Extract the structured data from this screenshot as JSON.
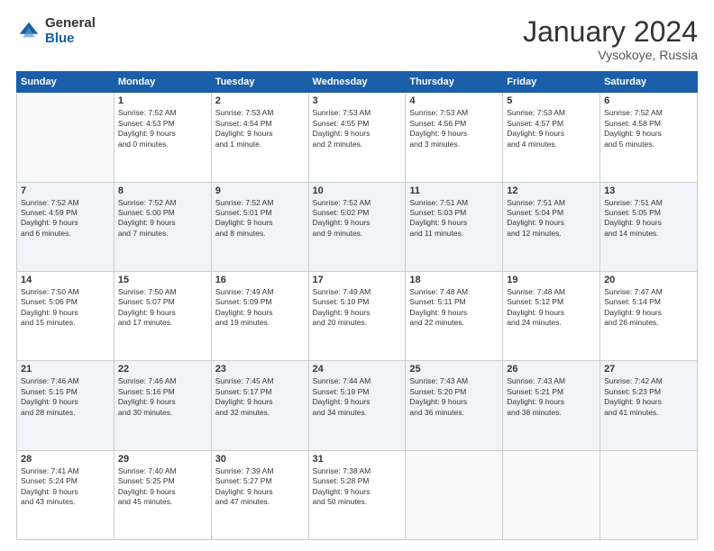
{
  "logo": {
    "general": "General",
    "blue": "Blue"
  },
  "calendar": {
    "title": "January 2024",
    "location": "Vysokoye, Russia",
    "headers": [
      "Sunday",
      "Monday",
      "Tuesday",
      "Wednesday",
      "Thursday",
      "Friday",
      "Saturday"
    ],
    "weeks": [
      [
        {
          "day": "",
          "info": ""
        },
        {
          "day": "1",
          "info": "Sunrise: 7:52 AM\nSunset: 4:53 PM\nDaylight: 9 hours\nand 0 minutes."
        },
        {
          "day": "2",
          "info": "Sunrise: 7:53 AM\nSunset: 4:54 PM\nDaylight: 9 hours\nand 1 minute."
        },
        {
          "day": "3",
          "info": "Sunrise: 7:53 AM\nSunset: 4:55 PM\nDaylight: 9 hours\nand 2 minutes."
        },
        {
          "day": "4",
          "info": "Sunrise: 7:53 AM\nSunset: 4:56 PM\nDaylight: 9 hours\nand 3 minutes."
        },
        {
          "day": "5",
          "info": "Sunrise: 7:53 AM\nSunset: 4:57 PM\nDaylight: 9 hours\nand 4 minutes."
        },
        {
          "day": "6",
          "info": "Sunrise: 7:52 AM\nSunset: 4:58 PM\nDaylight: 9 hours\nand 5 minutes."
        }
      ],
      [
        {
          "day": "7",
          "info": "Sunrise: 7:52 AM\nSunset: 4:59 PM\nDaylight: 9 hours\nand 6 minutes."
        },
        {
          "day": "8",
          "info": "Sunrise: 7:52 AM\nSunset: 5:00 PM\nDaylight: 9 hours\nand 7 minutes."
        },
        {
          "day": "9",
          "info": "Sunrise: 7:52 AM\nSunset: 5:01 PM\nDaylight: 9 hours\nand 8 minutes."
        },
        {
          "day": "10",
          "info": "Sunrise: 7:52 AM\nSunset: 5:02 PM\nDaylight: 9 hours\nand 9 minutes."
        },
        {
          "day": "11",
          "info": "Sunrise: 7:51 AM\nSunset: 5:03 PM\nDaylight: 9 hours\nand 11 minutes."
        },
        {
          "day": "12",
          "info": "Sunrise: 7:51 AM\nSunset: 5:04 PM\nDaylight: 9 hours\nand 12 minutes."
        },
        {
          "day": "13",
          "info": "Sunrise: 7:51 AM\nSunset: 5:05 PM\nDaylight: 9 hours\nand 14 minutes."
        }
      ],
      [
        {
          "day": "14",
          "info": "Sunrise: 7:50 AM\nSunset: 5:06 PM\nDaylight: 9 hours\nand 15 minutes."
        },
        {
          "day": "15",
          "info": "Sunrise: 7:50 AM\nSunset: 5:07 PM\nDaylight: 9 hours\nand 17 minutes."
        },
        {
          "day": "16",
          "info": "Sunrise: 7:49 AM\nSunset: 5:09 PM\nDaylight: 9 hours\nand 19 minutes."
        },
        {
          "day": "17",
          "info": "Sunrise: 7:49 AM\nSunset: 5:10 PM\nDaylight: 9 hours\nand 20 minutes."
        },
        {
          "day": "18",
          "info": "Sunrise: 7:48 AM\nSunset: 5:11 PM\nDaylight: 9 hours\nand 22 minutes."
        },
        {
          "day": "19",
          "info": "Sunrise: 7:48 AM\nSunset: 5:12 PM\nDaylight: 9 hours\nand 24 minutes."
        },
        {
          "day": "20",
          "info": "Sunrise: 7:47 AM\nSunset: 5:14 PM\nDaylight: 9 hours\nand 26 minutes."
        }
      ],
      [
        {
          "day": "21",
          "info": "Sunrise: 7:46 AM\nSunset: 5:15 PM\nDaylight: 9 hours\nand 28 minutes."
        },
        {
          "day": "22",
          "info": "Sunrise: 7:46 AM\nSunset: 5:16 PM\nDaylight: 9 hours\nand 30 minutes."
        },
        {
          "day": "23",
          "info": "Sunrise: 7:45 AM\nSunset: 5:17 PM\nDaylight: 9 hours\nand 32 minutes."
        },
        {
          "day": "24",
          "info": "Sunrise: 7:44 AM\nSunset: 5:19 PM\nDaylight: 9 hours\nand 34 minutes."
        },
        {
          "day": "25",
          "info": "Sunrise: 7:43 AM\nSunset: 5:20 PM\nDaylight: 9 hours\nand 36 minutes."
        },
        {
          "day": "26",
          "info": "Sunrise: 7:43 AM\nSunset: 5:21 PM\nDaylight: 9 hours\nand 38 minutes."
        },
        {
          "day": "27",
          "info": "Sunrise: 7:42 AM\nSunset: 5:23 PM\nDaylight: 9 hours\nand 41 minutes."
        }
      ],
      [
        {
          "day": "28",
          "info": "Sunrise: 7:41 AM\nSunset: 5:24 PM\nDaylight: 9 hours\nand 43 minutes."
        },
        {
          "day": "29",
          "info": "Sunrise: 7:40 AM\nSunset: 5:25 PM\nDaylight: 9 hours\nand 45 minutes."
        },
        {
          "day": "30",
          "info": "Sunrise: 7:39 AM\nSunset: 5:27 PM\nDaylight: 9 hours\nand 47 minutes."
        },
        {
          "day": "31",
          "info": "Sunrise: 7:38 AM\nSunset: 5:28 PM\nDaylight: 9 hours\nand 50 minutes."
        },
        {
          "day": "",
          "info": ""
        },
        {
          "day": "",
          "info": ""
        },
        {
          "day": "",
          "info": ""
        }
      ]
    ]
  }
}
